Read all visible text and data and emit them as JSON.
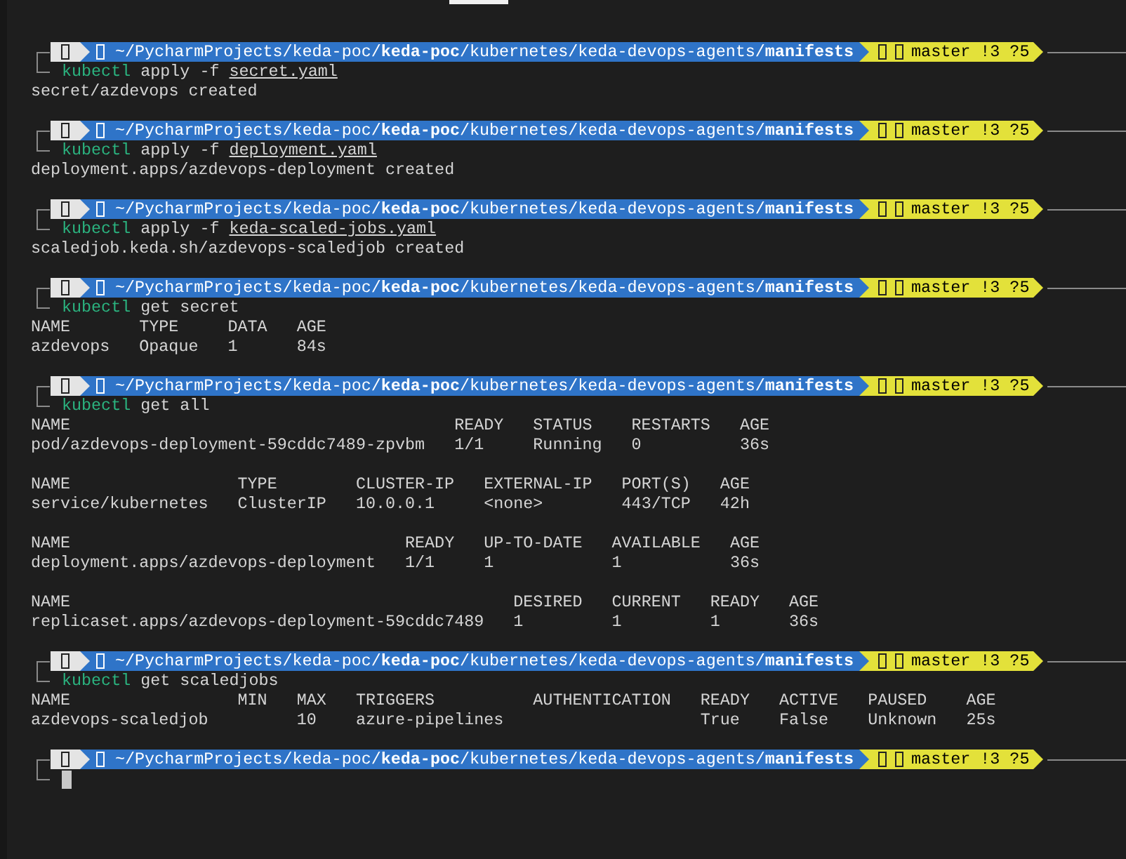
{
  "blocks": [
    {
      "prompt": {
        "path": "~/PycharmProjects/keda-poc/**keda-poc**/kubernetes/keda-devops-agents/**manifests**",
        "branch": "master !3 ?5"
      },
      "command": {
        "program": "kubectl",
        "args": "apply -f",
        "file": "secret.yaml"
      },
      "output": [
        {
          "kind": "text",
          "text": "secret/azdevops created"
        }
      ]
    },
    {
      "prompt": {
        "path": "~/PycharmProjects/keda-poc/**keda-poc**/kubernetes/keda-devops-agents/**manifests**",
        "branch": "master !3 ?5"
      },
      "command": {
        "program": "kubectl",
        "args": "apply -f",
        "file": "deployment.yaml"
      },
      "output": [
        {
          "kind": "text",
          "text": "deployment.apps/azdevops-deployment created"
        }
      ]
    },
    {
      "prompt": {
        "path": "~/PycharmProjects/keda-poc/**keda-poc**/kubernetes/keda-devops-agents/**manifests**",
        "branch": "master !3 ?5"
      },
      "command": {
        "program": "kubectl",
        "args": "apply -f",
        "file": "keda-scaled-jobs.yaml"
      },
      "output": [
        {
          "kind": "text",
          "text": "scaledjob.keda.sh/azdevops-scaledjob created"
        }
      ]
    },
    {
      "prompt": {
        "path": "~/PycharmProjects/keda-poc/**keda-poc**/kubernetes/keda-devops-agents/**manifests**",
        "branch": "master !3 ?5"
      },
      "command": {
        "program": "kubectl",
        "args": "get secret"
      },
      "output": [
        {
          "kind": "table",
          "columns": [
            "NAME",
            "TYPE",
            "DATA",
            "AGE"
          ],
          "rows": [
            [
              "azdevops",
              "Opaque",
              "1",
              "84s"
            ]
          ]
        }
      ]
    },
    {
      "prompt": {
        "path": "~/PycharmProjects/keda-poc/**keda-poc**/kubernetes/keda-devops-agents/**manifests**",
        "branch": "master !3 ?5"
      },
      "command": {
        "program": "kubectl",
        "args": "get all"
      },
      "output": [
        {
          "kind": "table",
          "columns": [
            "NAME",
            "READY",
            "STATUS",
            "RESTARTS",
            "AGE"
          ],
          "rows": [
            [
              "pod/azdevops-deployment-59cddc7489-zpvbm",
              "1/1",
              "Running",
              "0",
              "36s"
            ]
          ]
        },
        {
          "kind": "table",
          "columns": [
            "NAME",
            "TYPE",
            "CLUSTER-IP",
            "EXTERNAL-IP",
            "PORT(S)",
            "AGE"
          ],
          "rows": [
            [
              "service/kubernetes",
              "ClusterIP",
              "10.0.0.1",
              "<none>",
              "443/TCP",
              "42h"
            ]
          ]
        },
        {
          "kind": "table",
          "columns": [
            "NAME",
            "READY",
            "UP-TO-DATE",
            "AVAILABLE",
            "AGE"
          ],
          "rows": [
            [
              "deployment.apps/azdevops-deployment",
              "1/1",
              "1",
              "1",
              "36s"
            ]
          ]
        },
        {
          "kind": "table",
          "columns": [
            "NAME",
            "DESIRED",
            "CURRENT",
            "READY",
            "AGE"
          ],
          "rows": [
            [
              "replicaset.apps/azdevops-deployment-59cddc7489",
              "1",
              "1",
              "1",
              "36s"
            ]
          ]
        }
      ]
    },
    {
      "prompt": {
        "path": "~/PycharmProjects/keda-poc/**keda-poc**/kubernetes/keda-devops-agents/**manifests**",
        "branch": "master !3 ?5"
      },
      "command": {
        "program": "kubectl",
        "args": "get scaledjobs"
      },
      "output": [
        {
          "kind": "table",
          "columns": [
            "NAME",
            "MIN",
            "MAX",
            "TRIGGERS",
            "AUTHENTICATION",
            "READY",
            "ACTIVE",
            "PAUSED",
            "AGE"
          ],
          "rows": [
            [
              "azdevops-scaledjob",
              null,
              "10",
              "azure-pipelines",
              null,
              "True",
              "False",
              "Unknown",
              "25s"
            ]
          ]
        }
      ]
    },
    {
      "prompt": {
        "path": "~/PycharmProjects/keda-poc/**keda-poc**/kubernetes/keda-devops-agents/**manifests**",
        "branch": "master !3 ?5"
      },
      "cursor": true
    }
  ]
}
